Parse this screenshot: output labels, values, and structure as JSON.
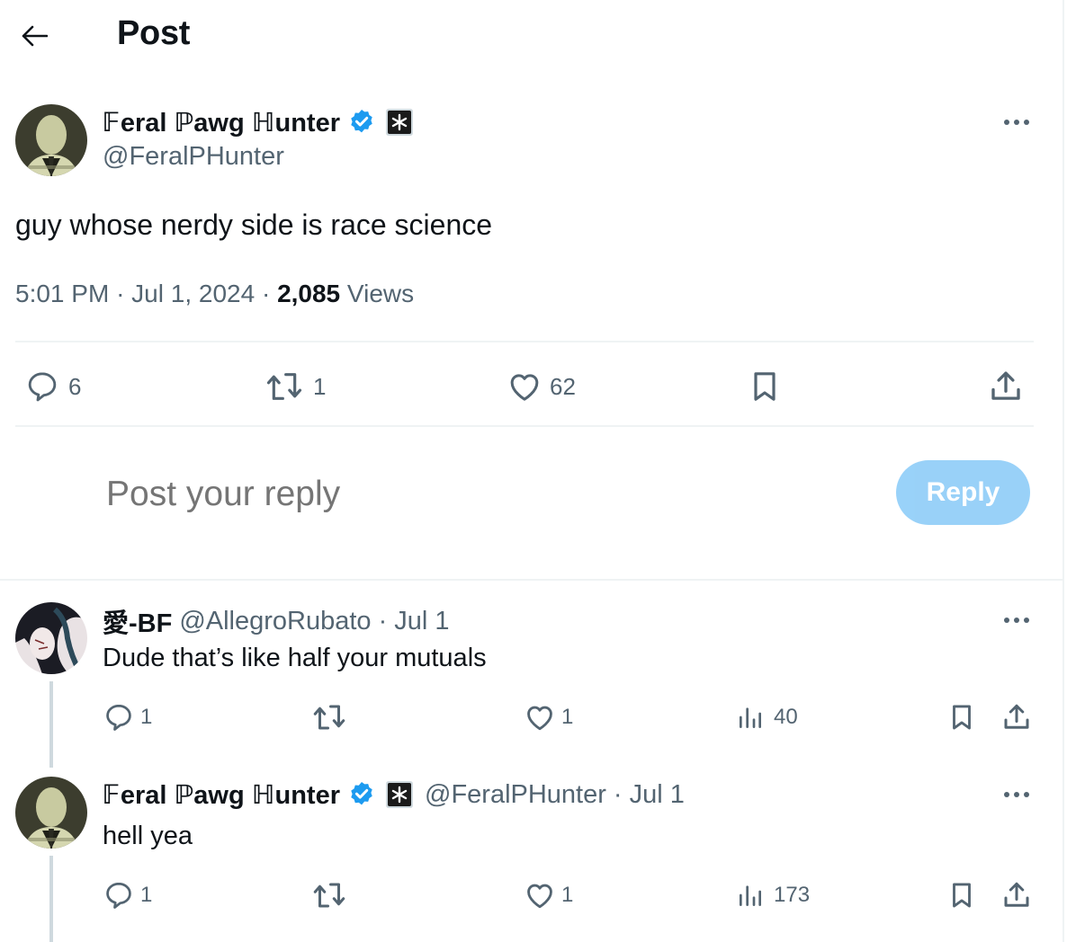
{
  "header": {
    "back_label": "Back",
    "title": "Post"
  },
  "main_post": {
    "author": {
      "display_name": "𝔽eral ℙawg ℍunter",
      "handle": "@FeralPHunter",
      "verified": true,
      "affiliation_badge": "asterisk-badge"
    },
    "text": "guy whose nerdy side is race science",
    "time": "5:01 PM",
    "date": "Jul 1, 2024",
    "separator": "·",
    "views_count": "2,085",
    "views_label": "Views",
    "actions": {
      "replies": "6",
      "reposts": "1",
      "likes": "62"
    }
  },
  "compose": {
    "placeholder": "Post your reply",
    "reply_button": "Reply"
  },
  "replies": [
    {
      "display_name": "愛-BF",
      "handle": "@AllegroRubato",
      "date": "· Jul 1",
      "text": "Dude that’s like half your mutuals",
      "verified": false,
      "actions": {
        "replies": "1",
        "reposts": "",
        "likes": "1",
        "views": "40"
      }
    },
    {
      "display_name": "𝔽eral ℙawg ℍunter",
      "handle": "@FeralPHunter",
      "date": "· Jul 1",
      "text": "hell yea",
      "verified": true,
      "affiliation_badge": "asterisk-badge",
      "actions": {
        "replies": "1",
        "reposts": "",
        "likes": "1",
        "views": "173"
      }
    }
  ],
  "colors": {
    "text_primary": "#0f1419",
    "text_secondary": "#536471",
    "verified_blue": "#1d9bf0",
    "reply_button_disabled": "#8ecdf8",
    "divider": "#eff3f4"
  }
}
